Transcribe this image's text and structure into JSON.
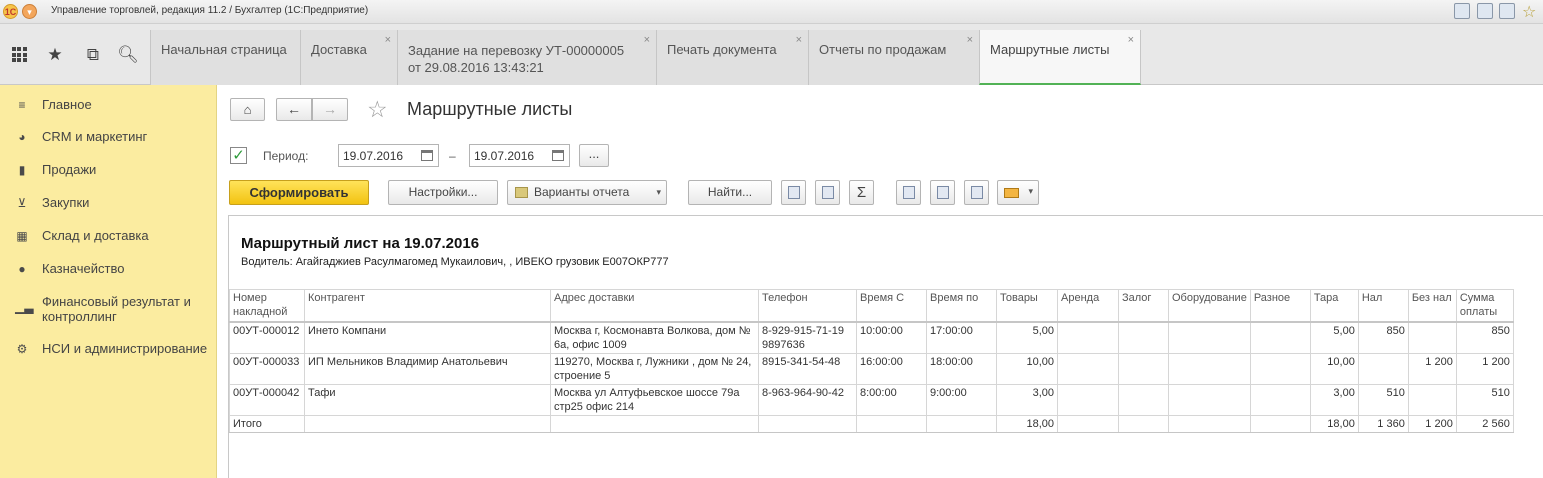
{
  "titlebar": {
    "title": "Управление торговлей, редакция 11.2 / Бухгалтер  (1С:Предприятие)",
    "logo_icon": "1c-logo-icon",
    "menu_icon": "main-menu-icon"
  },
  "nav_icons": [
    "apps-icon",
    "favorites-icon",
    "history-icon",
    "search-icon"
  ],
  "tabs": [
    {
      "label": "Начальная страница"
    },
    {
      "label": "Доставка"
    },
    {
      "label": "Задание на перевозку УТ-00000005",
      "label2": "от 29.08.2016 13:43:21"
    },
    {
      "label": "Печать документа"
    },
    {
      "label": "Отчеты по продажам"
    },
    {
      "label": "Маршрутные листы"
    }
  ],
  "tab_close": "×",
  "sidebar": {
    "items": [
      {
        "label": "Главное",
        "icon": "menu-lines-icon"
      },
      {
        "label": "CRM и маркетинг",
        "icon": "pie-icon"
      },
      {
        "label": "Продажи",
        "icon": "bag-icon"
      },
      {
        "label": "Закупки",
        "icon": "cart-icon"
      },
      {
        "label": "Склад и доставка",
        "icon": "grid-icon"
      },
      {
        "label": "Казначейство",
        "icon": "coin-icon"
      },
      {
        "label": "Финансовый результат и контроллинг",
        "icon": "bar-chart-icon"
      },
      {
        "label": "НСИ и администрирование",
        "icon": "gear-icon"
      }
    ],
    "bg_color": "#fbeca0"
  },
  "main": {
    "title": "Маршрутные листы",
    "period_label": "Период:",
    "date_from": "19.07.2016",
    "date_to": "19.07.2016",
    "dash": "–",
    "dots": "...",
    "period_checked": true,
    "generate_label": "Сформировать",
    "settings_label": "Настройки...",
    "variants_label": "Варианты отчета",
    "find_label": "Найти...",
    "sigma": "Σ"
  },
  "report": {
    "title": "Маршрутный лист на 19.07.2016",
    "subtitle": "Водитель: Агайгаджиев Расулмагомед Мукаилович, , ИВЕКО грузовик Е007ОКР777",
    "columns": [
      "Номер накладной",
      "Контрагент",
      "Адрес доставки",
      "Телефон",
      "Время С",
      "Время по",
      "Товары",
      "Аренда",
      "Залог",
      "Оборудование",
      "Разное",
      "Тара",
      "Нал",
      "Без нал",
      "Сумма оплаты"
    ],
    "rows": [
      [
        "00УТ-000012",
        "Инето Компани",
        "Москва г, Космонавта Волкова, дом № 6а, офис 1009",
        "8-929-915-71-19 9897636",
        "10:00:00",
        "17:00:00",
        "5,00",
        "",
        "",
        "",
        "",
        "5,00",
        "850",
        "",
        "850"
      ],
      [
        "00УТ-000033",
        "ИП Мельников Владимир Анатольевич",
        "119270, Москва г, Лужники , дом № 24, строение 5",
        "8915-341-54-48",
        "16:00:00",
        "18:00:00",
        "10,00",
        "",
        "",
        "",
        "",
        "10,00",
        "",
        "1 200",
        "1 200"
      ],
      [
        "00УТ-000042",
        "Тафи",
        "Москва ул Алтуфьевское шоссе 79а стр25 офис 214",
        "8-963-964-90-42",
        "8:00:00",
        "9:00:00",
        "3,00",
        "",
        "",
        "",
        "",
        "3,00",
        "510",
        "",
        "510"
      ]
    ],
    "total": [
      "Итого",
      "",
      "",
      "",
      "",
      "",
      "18,00",
      "",
      "",
      "",
      "",
      "18,00",
      "1 360",
      "1 200",
      "2 560"
    ]
  }
}
